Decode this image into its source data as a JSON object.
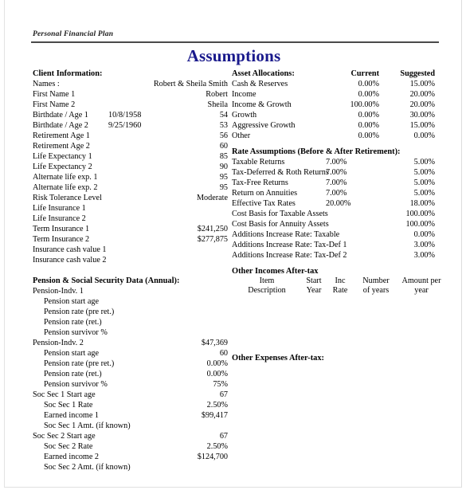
{
  "header": {
    "running_head": "Personal Financial Plan",
    "title": "Assumptions",
    "title_color": "#1a1a8c"
  },
  "left_column": {
    "client_information": {
      "heading": "Client Information:",
      "rows": [
        {
          "label": "Names :",
          "indent": 0,
          "mid": "",
          "value": "Robert & Sheila Smith"
        },
        {
          "label": "First Name 1",
          "indent": 0,
          "mid": "",
          "value": "Robert"
        },
        {
          "label": "First Name 2",
          "indent": 0,
          "mid": "",
          "value": "Sheila"
        },
        {
          "label": "Birthdate / Age 1",
          "indent": 0,
          "mid": "10/8/1958",
          "value": "54"
        },
        {
          "label": "Birthdate / Age 2",
          "indent": 0,
          "mid": "9/25/1960",
          "value": "53"
        },
        {
          "label": "Retirement Age 1",
          "indent": 0,
          "mid": "",
          "value": "56"
        },
        {
          "label": "Retirement Age 2",
          "indent": 0,
          "mid": "",
          "value": "60"
        },
        {
          "label": "Life Expectancy 1",
          "indent": 0,
          "mid": "",
          "value": "85"
        },
        {
          "label": "Life Expectancy 2",
          "indent": 0,
          "mid": "",
          "value": "90"
        },
        {
          "label": "Alternate life exp. 1",
          "indent": 0,
          "mid": "",
          "value": "95"
        },
        {
          "label": "Alternate life exp. 2",
          "indent": 0,
          "mid": "",
          "value": "95"
        },
        {
          "label": "Risk Tolerance Level",
          "indent": 0,
          "mid": "",
          "value": "Moderate"
        },
        {
          "label": "Life Insurance 1",
          "indent": 0,
          "mid": "",
          "value": ""
        },
        {
          "label": "Life Insurance 2",
          "indent": 0,
          "mid": "",
          "value": ""
        },
        {
          "label": "Term Insurance 1",
          "indent": 0,
          "mid": "",
          "value": "$241,250"
        },
        {
          "label": "Term Insurance 2",
          "indent": 0,
          "mid": "",
          "value": "$277,875"
        },
        {
          "label": "Insurance cash value 1",
          "indent": 0,
          "mid": "",
          "value": ""
        },
        {
          "label": "Insurance cash value 2",
          "indent": 0,
          "mid": "",
          "value": ""
        }
      ]
    },
    "pension_social_security": {
      "heading": "Pension & Social Security Data (Annual):",
      "rows": [
        {
          "label": "Pension-Indv. 1",
          "indent": 0,
          "value": ""
        },
        {
          "label": "Pension start age",
          "indent": 1,
          "value": ""
        },
        {
          "label": "Pension rate (pre ret.)",
          "indent": 1,
          "value": ""
        },
        {
          "label": "Pension rate (ret.)",
          "indent": 1,
          "value": ""
        },
        {
          "label": "Pension survivor %",
          "indent": 1,
          "value": ""
        },
        {
          "label": "Pension-Indv. 2",
          "indent": 0,
          "value": "$47,369"
        },
        {
          "label": "Pension start age",
          "indent": 1,
          "value": "60"
        },
        {
          "label": "Pension rate (pre ret.)",
          "indent": 1,
          "value": "0.00%"
        },
        {
          "label": "Pension rate (ret.)",
          "indent": 1,
          "value": "0.00%"
        },
        {
          "label": "Pension survivor %",
          "indent": 1,
          "value": "75%"
        },
        {
          "label": "Soc Sec 1 Start age",
          "indent": 0,
          "value": "67"
        },
        {
          "label": "Soc Sec 1 Rate",
          "indent": 1,
          "value": "2.50%"
        },
        {
          "label": "Earned income 1",
          "indent": 1,
          "value": "$99,417"
        },
        {
          "label": "Soc Sec 1 Amt. (if known)",
          "indent": 1,
          "value": ""
        },
        {
          "label": "Soc Sec 2 Start age",
          "indent": 0,
          "value": "67"
        },
        {
          "label": "Soc Sec 2 Rate",
          "indent": 1,
          "value": "2.50%"
        },
        {
          "label": "Earned income 2",
          "indent": 1,
          "value": "$124,700"
        },
        {
          "label": "Soc Sec 2 Amt. (if known)",
          "indent": 1,
          "value": ""
        }
      ]
    }
  },
  "right_column": {
    "asset_allocations": {
      "heading": "Asset Allocations:",
      "col_current": "Current",
      "col_suggested": "Suggested",
      "rows": [
        {
          "label": "Cash & Reserves",
          "current": "0.00%",
          "suggested": "15.00%"
        },
        {
          "label": "Income",
          "current": "0.00%",
          "suggested": "20.00%"
        },
        {
          "label": "Income & Growth",
          "current": "100.00%",
          "suggested": "20.00%"
        },
        {
          "label": "Growth",
          "current": "0.00%",
          "suggested": "30.00%"
        },
        {
          "label": "Aggressive Growth",
          "current": "0.00%",
          "suggested": "15.00%"
        },
        {
          "label": "Other",
          "current": "0.00%",
          "suggested": "0.00%"
        }
      ]
    },
    "rate_assumptions": {
      "heading": "Rate Assumptions (Before & After Retirement):",
      "rows": [
        {
          "label": "Taxable Returns",
          "before": "7.00%",
          "after": "5.00%"
        },
        {
          "label": "Tax-Deferred & Roth Returns",
          "before": "7.00%",
          "after": "5.00%"
        },
        {
          "label": "Tax-Free Returns",
          "before": "7.00%",
          "after": "5.00%"
        },
        {
          "label": "Return on Annuities",
          "before": "7.00%",
          "after": "5.00%"
        },
        {
          "label": "Effective Tax Rates",
          "before": "20.00%",
          "after": "18.00%"
        },
        {
          "label": "Cost Basis for Taxable Assets",
          "before": "",
          "after": "100.00%"
        },
        {
          "label": "Cost Basis for Annuity Assets",
          "before": "",
          "after": "100.00%"
        },
        {
          "label": "Additions Increase Rate:  Taxable",
          "before": "",
          "after": "0.00%"
        },
        {
          "label": "Additions Increase Rate:  Tax-Def 1",
          "before": "",
          "after": "3.00%"
        },
        {
          "label": "Additions Increase Rate:  Tax-Def 2",
          "before": "",
          "after": "3.00%"
        }
      ]
    },
    "other_incomes": {
      "heading": "Other Incomes After-tax",
      "columns": [
        {
          "line1": "Item",
          "line2": "Description"
        },
        {
          "line1": "Start",
          "line2": "Year"
        },
        {
          "line1": "Inc",
          "line2": "Rate"
        },
        {
          "line1": "Number",
          "line2": "of years"
        },
        {
          "line1": "Amount per",
          "line2": "year"
        }
      ],
      "rows": []
    },
    "other_expenses": {
      "heading": "Other Expenses After-tax:"
    }
  }
}
